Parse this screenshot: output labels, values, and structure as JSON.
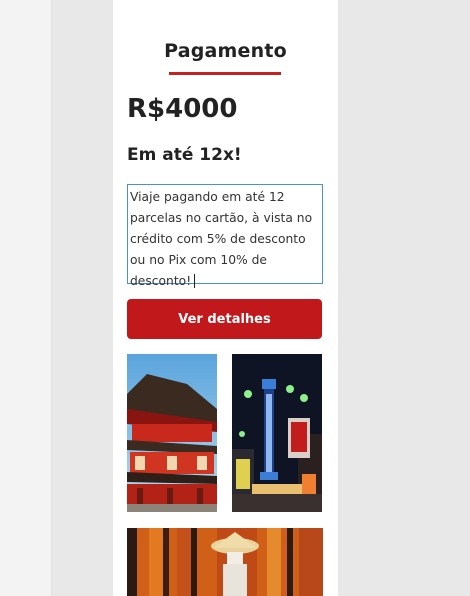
{
  "card": {
    "title": "Pagamento",
    "price": "R$4000",
    "installments": "Em até 12x!",
    "description": "Viaje pagando em até 12 parcelas no cartão, à vista no crédito com 5% de desconto ou no Pix com 10% de desconto!",
    "button_label": "Ver detalhes"
  },
  "colors": {
    "accent": "#c0181b",
    "underline": "#c8201e",
    "focus_border": "#4a90d9"
  },
  "photos": [
    {
      "name": "japanese-temple-photo"
    },
    {
      "name": "tsutenkaku-tower-night-photo"
    },
    {
      "name": "torii-gates-photo"
    }
  ]
}
